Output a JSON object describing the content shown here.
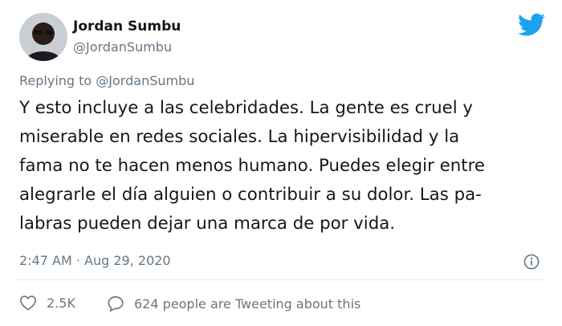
{
  "author": {
    "name": "Jordan Sumbu",
    "handle": "@JordanSumbu"
  },
  "reply": {
    "prefix": "Replying to ",
    "target": "@JordanSumbu"
  },
  "tweet": {
    "lines": [
      "Y esto incluye a las celebridades. La gente es cruel y",
      "miserable en redes sociales. La hipervisibilidad y la",
      "fama no te hacen menos humano. Puedes elegir entre",
      "alegrarle el día alguien o contribuir a su dolor. Las pa-",
      "labras pueden dejar una marca de por vida."
    ],
    "timestamp": "2:47 AM · Aug 29, 2020"
  },
  "actions": {
    "likes_count": "2.5K",
    "conversation_text": "624 people are Tweeting about this"
  },
  "icons": {
    "brand": "twitter-bird-icon",
    "info": "info-icon",
    "like": "heart-icon",
    "conversation": "speech-bubble-icon"
  },
  "colors": {
    "twitter_blue": "#1DA1F2",
    "secondary_text": "#657786",
    "primary_text": "#14171a"
  }
}
